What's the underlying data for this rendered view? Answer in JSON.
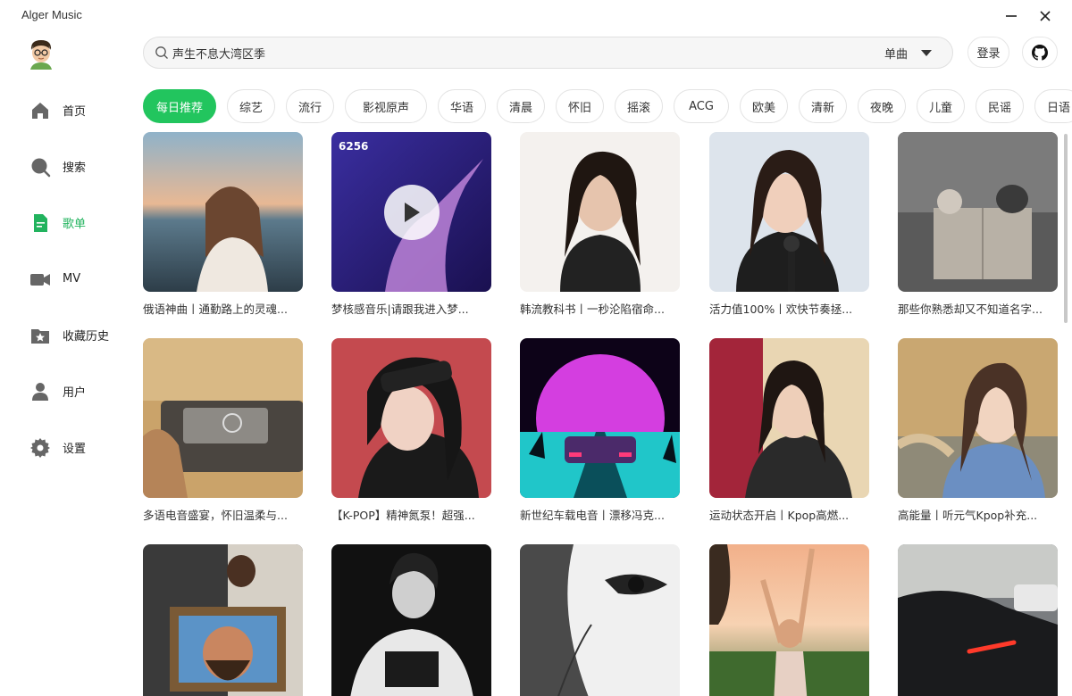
{
  "app": {
    "title": "Alger Music"
  },
  "window": {
    "minimize": "—",
    "close": "✕"
  },
  "sidebar": {
    "items": [
      {
        "label": "首页",
        "icon": "home-icon"
      },
      {
        "label": "搜索",
        "icon": "search-icon"
      },
      {
        "label": "歌单",
        "icon": "playlist-icon",
        "active": true
      },
      {
        "label": "MV",
        "icon": "video-icon"
      },
      {
        "label": "收藏历史",
        "icon": "favorites-icon"
      },
      {
        "label": "用户",
        "icon": "user-icon"
      },
      {
        "label": "设置",
        "icon": "gear-icon"
      }
    ]
  },
  "header": {
    "search_value": "声生不息大湾区季",
    "search_type": "单曲",
    "login_label": "登录"
  },
  "categories": [
    "每日推荐",
    "综艺",
    "流行",
    "影视原声",
    "华语",
    "清晨",
    "怀旧",
    "摇滚",
    "ACG",
    "欧美",
    "清新",
    "夜晚",
    "儿童",
    "民谣",
    "日语"
  ],
  "active_category": "每日推荐",
  "playlists": [
    {
      "title": "俄语神曲丨通勤路上的灵魂..."
    },
    {
      "title": "梦核感音乐|请跟我进入梦...",
      "play_count": "6256"
    },
    {
      "title": "韩流教科书丨一秒沦陷宿命..."
    },
    {
      "title": "活力值100%丨欢快节奏拯..."
    },
    {
      "title": "那些你熟悉却又不知道名字..."
    },
    {
      "title": "多语电音盛宴，怀旧温柔与..."
    },
    {
      "title": "【K-POP】精神氮泵！超强..."
    },
    {
      "title": "新世纪车载电音丨漂移冯克..."
    },
    {
      "title": "运动状态开启丨Kpop高燃..."
    },
    {
      "title": "高能量丨听元气Kpop补充..."
    },
    {
      "title": ""
    },
    {
      "title": ""
    },
    {
      "title": ""
    },
    {
      "title": ""
    },
    {
      "title": ""
    }
  ],
  "colors": {
    "accent": "#22c55e",
    "active_text": "#22b35e"
  }
}
